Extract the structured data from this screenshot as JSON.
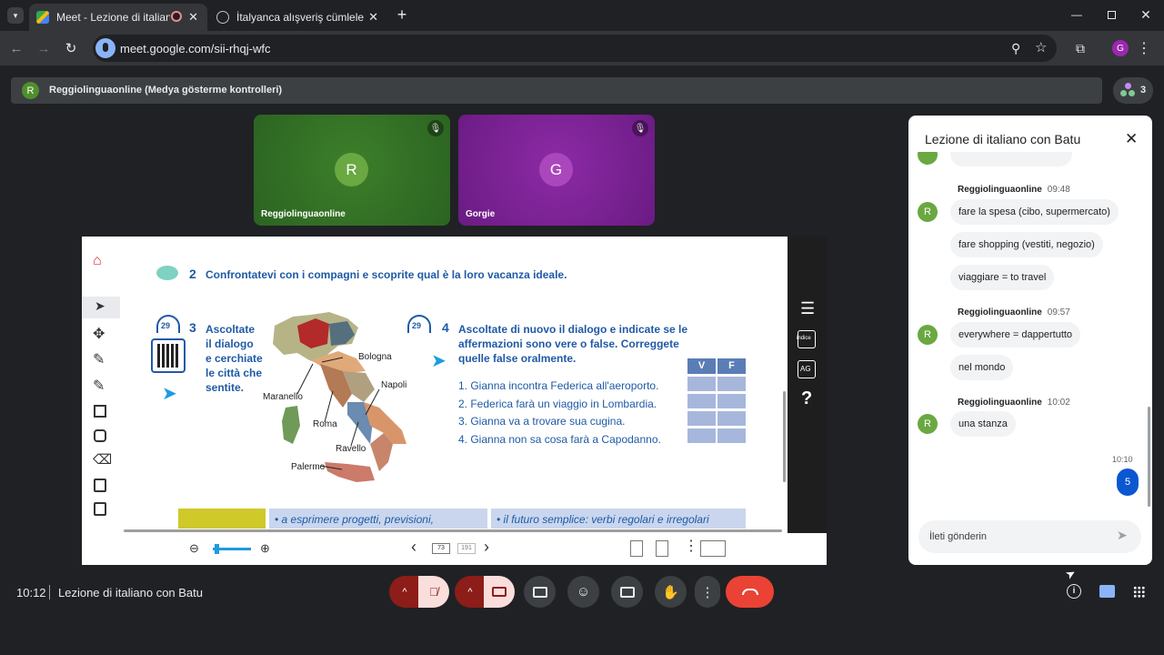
{
  "browser": {
    "tabs": [
      {
        "title": "Meet - Lezione di italiano c",
        "active": true
      },
      {
        "title": "İtalyanca alışveriş cümleleri",
        "active": false
      }
    ],
    "url": "meet.google.com/sii-rhqj-wfc",
    "profile_initial": "G"
  },
  "share_bar": {
    "initial": "R",
    "text": "Reggiolinguaonline (Medya gösterme kontrolleri)",
    "participants_count": "3"
  },
  "tiles": [
    {
      "initial": "R",
      "name": "Reggiolinguaonline",
      "color": "#4f8f2b"
    },
    {
      "initial": "G",
      "name": "Gorgie",
      "color": "#7b1fa2"
    }
  ],
  "board": {
    "ex2": {
      "num": "2",
      "text": "Confrontatevi con i compagni e scoprite qual è la loro vacanza ideale."
    },
    "ex3": {
      "badge": "29",
      "num": "3",
      "lines": [
        "Ascoltate",
        "il dialogo",
        "e cerchiate",
        "le città che",
        "sentite."
      ]
    },
    "map_labels": [
      "Bologna",
      "Napoli",
      "Maranello",
      "Roma",
      "Ravello",
      "Palermo"
    ],
    "ex4": {
      "badge": "29",
      "num": "4",
      "lines": [
        "Ascoltate di nuovo il dialogo e indicate se le",
        "affermazioni sono vere o false. Correggete",
        "quelle false oralmente."
      ]
    },
    "statements": [
      "1.  Gianna incontra Federica all'aeroporto.",
      "2.  Federica farà un viaggio in Lombardia.",
      "3.  Gianna va a trovare sua cugina.",
      "4.  Gianna non sa cosa farà a Capodanno."
    ],
    "vf_headers": [
      "V",
      "F"
    ],
    "bottom_strip": [
      "• a esprimere progetti, previsioni,",
      "• il futuro semplice: verbi regolari e irregolari"
    ],
    "right_tools": [
      "☰",
      "indice",
      "AG",
      "?"
    ],
    "page_current": "73",
    "page_total": "191"
  },
  "chat": {
    "title": "Lezione di italiano con Batu",
    "groups": [
      {
        "sender": "Reggiolinguaonline",
        "time": "09:48",
        "messages": [
          "fare la spesa (cibo, supermercato)",
          "fare shopping (vestiti, negozio)",
          "viaggiare = to travel"
        ]
      },
      {
        "sender": "Reggiolinguaonline",
        "time": "09:57",
        "messages": [
          "everywhere = dappertutto",
          "nel mondo"
        ]
      },
      {
        "sender": "Reggiolinguaonline",
        "time": "10:02",
        "messages": [
          "una stanza"
        ]
      }
    ],
    "own_time": "10:10",
    "own_message": "5",
    "input_placeholder": "İleti gönderin"
  },
  "footer": {
    "time": "10:12",
    "meeting_title": "Lezione di italiano con Batu"
  },
  "colors": {
    "accent_red": "#ea4335",
    "mic_off_bg": "#f9dedc",
    "chat_active": "#8ab4f8"
  }
}
